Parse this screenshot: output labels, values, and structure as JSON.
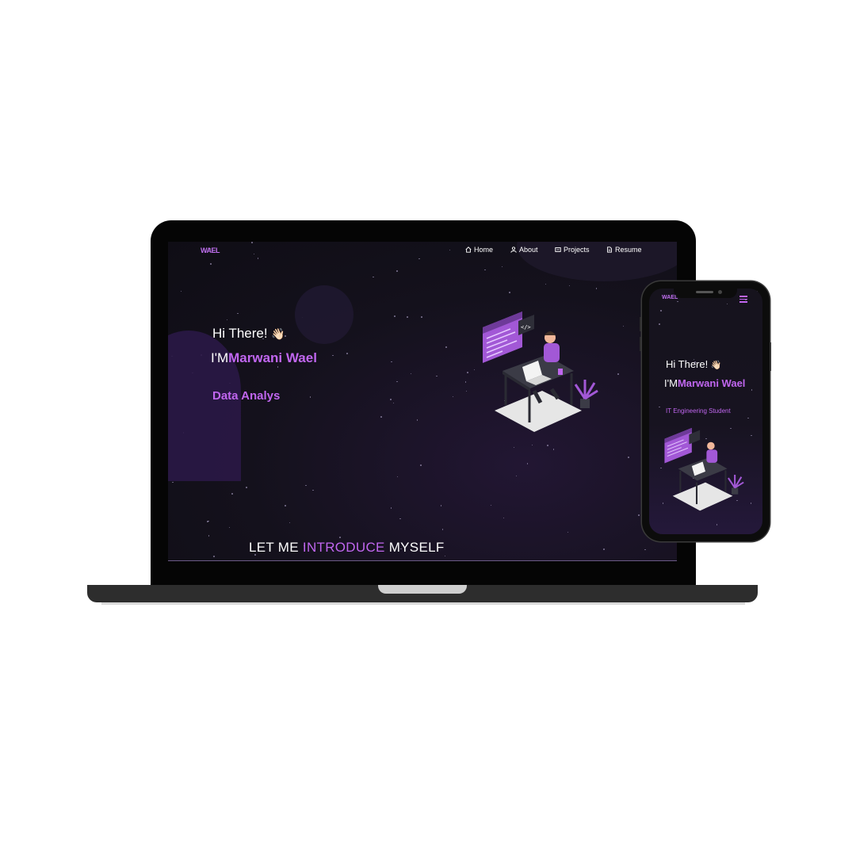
{
  "laptop": {
    "logo": "WAEL",
    "nav": [
      {
        "label": "Home",
        "icon": "home-icon"
      },
      {
        "label": "About",
        "icon": "user-icon"
      },
      {
        "label": "Projects",
        "icon": "projects-icon"
      },
      {
        "label": "Resume",
        "icon": "document-icon"
      }
    ],
    "greeting": "Hi There!",
    "wave": "👋🏻",
    "im_prefix": "I'M",
    "name": "Marwani Wael",
    "role": "Data Analys",
    "intro": {
      "part1": "LET ME ",
      "accent": "INTRODUCE",
      "part2": " MYSELF"
    }
  },
  "phone": {
    "logo": "WAEL",
    "greeting": "Hi There!",
    "wave": "👋🏻",
    "im_prefix": "I'M",
    "name": "Marwani Wael",
    "role": "IT Engineering Student"
  },
  "colors": {
    "accent": "#c066ef",
    "background": "#14111c"
  }
}
